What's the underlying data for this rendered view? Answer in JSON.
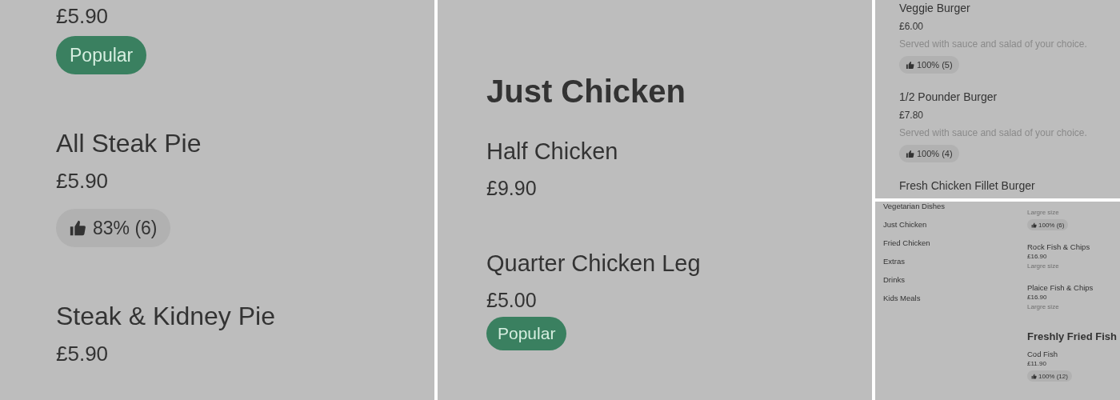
{
  "panels": [
    {
      "kind": "large",
      "entries": [
        {
          "kind": "item",
          "price": "£5.90",
          "badge": "Popular"
        },
        {
          "kind": "item",
          "name": "All Steak Pie",
          "price": "£5.90",
          "rating": "83% (6)"
        },
        {
          "kind": "item",
          "name": "Steak & Kidney Pie",
          "price": "£5.90"
        }
      ]
    },
    {
      "kind": "medium",
      "entries": [
        {
          "kind": "heading",
          "title": "Just Chicken"
        },
        {
          "kind": "item",
          "name": "Half Chicken",
          "price": "£9.90"
        },
        {
          "kind": "item",
          "name": "Quarter Chicken Leg",
          "price": "£5.00",
          "badge": "Popular"
        }
      ]
    },
    {
      "kind": "small",
      "entries": [
        {
          "kind": "item",
          "name": "Veggie Burger",
          "price": "£6.00",
          "description": "Served with sauce and salad of your choice.",
          "rating": "100% (5)"
        },
        {
          "kind": "item",
          "name": "1/2 Pounder Burger",
          "price": "£7.80",
          "description": "Served with sauce and salad of your choice.",
          "rating": "100% (4)"
        },
        {
          "kind": "item",
          "name": "Fresh Chicken Fillet Burger"
        }
      ]
    },
    {
      "kind": "tiny",
      "sidebar": {
        "items": [
          {
            "label": "Vegetarian Dishes"
          },
          {
            "label": "Just Chicken"
          },
          {
            "label": "Fried Chicken"
          },
          {
            "label": "Extras"
          },
          {
            "label": "Drinks"
          },
          {
            "label": "Kids Meals"
          }
        ]
      },
      "entries": [
        {
          "kind": "item",
          "description": "Largre size",
          "rating": "100% (6)"
        },
        {
          "kind": "item",
          "name": "Rock Fish & Chips",
          "price": "£16.90",
          "description": "Largre size"
        },
        {
          "kind": "item",
          "name": "Plaice Fish & Chips",
          "price": "£16.90",
          "description": "Largre size"
        },
        {
          "kind": "heading",
          "title": "Freshly Fried Fish"
        },
        {
          "kind": "item",
          "name": "Cod Fish",
          "price": "£11.90",
          "rating": "100% (12)"
        }
      ]
    }
  ]
}
